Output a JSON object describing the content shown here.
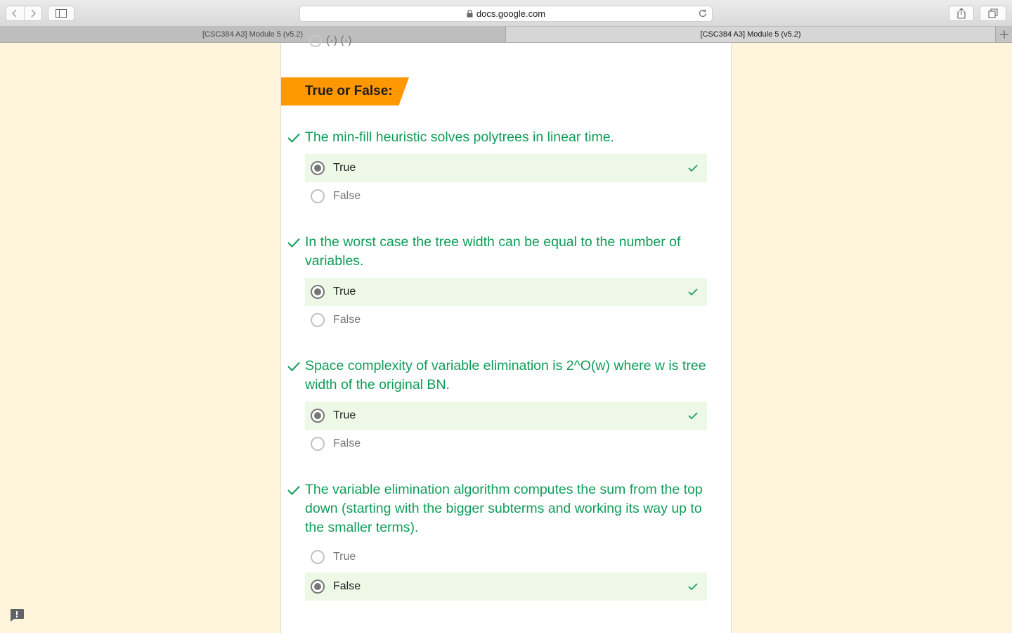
{
  "browser": {
    "url": "docs.google.com",
    "tabs": [
      {
        "title": "[CSC384 A3] Module 5 (v5.2)",
        "active": false
      },
      {
        "title": "[CSC384 A3] Module 5 (v5.2)",
        "active": true
      }
    ]
  },
  "partial_option_text": "(·) (·)",
  "section": {
    "title": "True or False:"
  },
  "colors": {
    "correct_text": "#0f9d58",
    "banner": "#ff9800",
    "correct_row": "#eef8e6",
    "page_background": "#fff4dc"
  },
  "questions": [
    {
      "text": "The min-fill heuristic solves polytrees in linear time.",
      "marked_correct": true,
      "options": [
        {
          "label": "True",
          "selected": true,
          "correct": true
        },
        {
          "label": "False",
          "selected": false,
          "correct": false
        }
      ]
    },
    {
      "text": "In the worst case the tree width can be equal to the number of variables.",
      "marked_correct": true,
      "options": [
        {
          "label": "True",
          "selected": true,
          "correct": true
        },
        {
          "label": "False",
          "selected": false,
          "correct": false
        }
      ]
    },
    {
      "text": "Space complexity of variable elimination is 2^O(w) where w is tree width of the original BN.",
      "marked_correct": true,
      "options": [
        {
          "label": "True",
          "selected": true,
          "correct": true
        },
        {
          "label": "False",
          "selected": false,
          "correct": false
        }
      ]
    },
    {
      "text": "The variable elimination algorithm computes the sum from the top down (starting with the bigger subterms and working its way up to the smaller terms).",
      "marked_correct": true,
      "options": [
        {
          "label": "True",
          "selected": false,
          "correct": false
        },
        {
          "label": "False",
          "selected": true,
          "correct": true
        }
      ]
    }
  ]
}
